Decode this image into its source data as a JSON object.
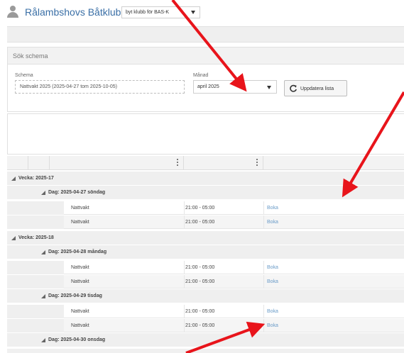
{
  "header": {
    "club_name": "Rålambshovs Båtklubb",
    "club_switch": "byt klubb för BAS-K"
  },
  "search": {
    "title": "Sök schema",
    "schema_label": "Schema",
    "schema_value": "Nattvakt 2025 (2025-04-27 tom 2025-10-05)",
    "month_label": "Månad",
    "month_value": "april 2025",
    "update_button": "Uppdatera lista"
  },
  "grid": {
    "weeks": [
      {
        "label": "Vecka: 2025-17",
        "days": [
          {
            "label": "Dag: 2025-04-27 söndag",
            "rows": [
              {
                "task": "Nattvakt",
                "time": "21:00 - 05:00",
                "action": "Boka"
              },
              {
                "task": "Nattvakt",
                "time": "21:00 - 05:00",
                "action": "Boka"
              }
            ]
          }
        ]
      },
      {
        "label": "Vecka: 2025-18",
        "days": [
          {
            "label": "Dag: 2025-04-28 måndag",
            "rows": [
              {
                "task": "Nattvakt",
                "time": "21:00 - 05:00",
                "action": "Boka"
              },
              {
                "task": "Nattvakt",
                "time": "21:00 - 05:00",
                "action": "Boka"
              }
            ]
          },
          {
            "label": "Dag: 2025-04-29 tisdag",
            "rows": [
              {
                "task": "Nattvakt",
                "time": "21:00 - 05:00",
                "action": "Boka"
              },
              {
                "task": "Nattvakt",
                "time": "21:00 - 05:00",
                "action": "Boka"
              }
            ]
          },
          {
            "label": "Dag: 2025-04-30 onsdag",
            "rows": []
          }
        ]
      }
    ]
  },
  "colors": {
    "accent": "#3a6fa6",
    "link": "#6a9bc8",
    "arrow": "#e8141b"
  }
}
